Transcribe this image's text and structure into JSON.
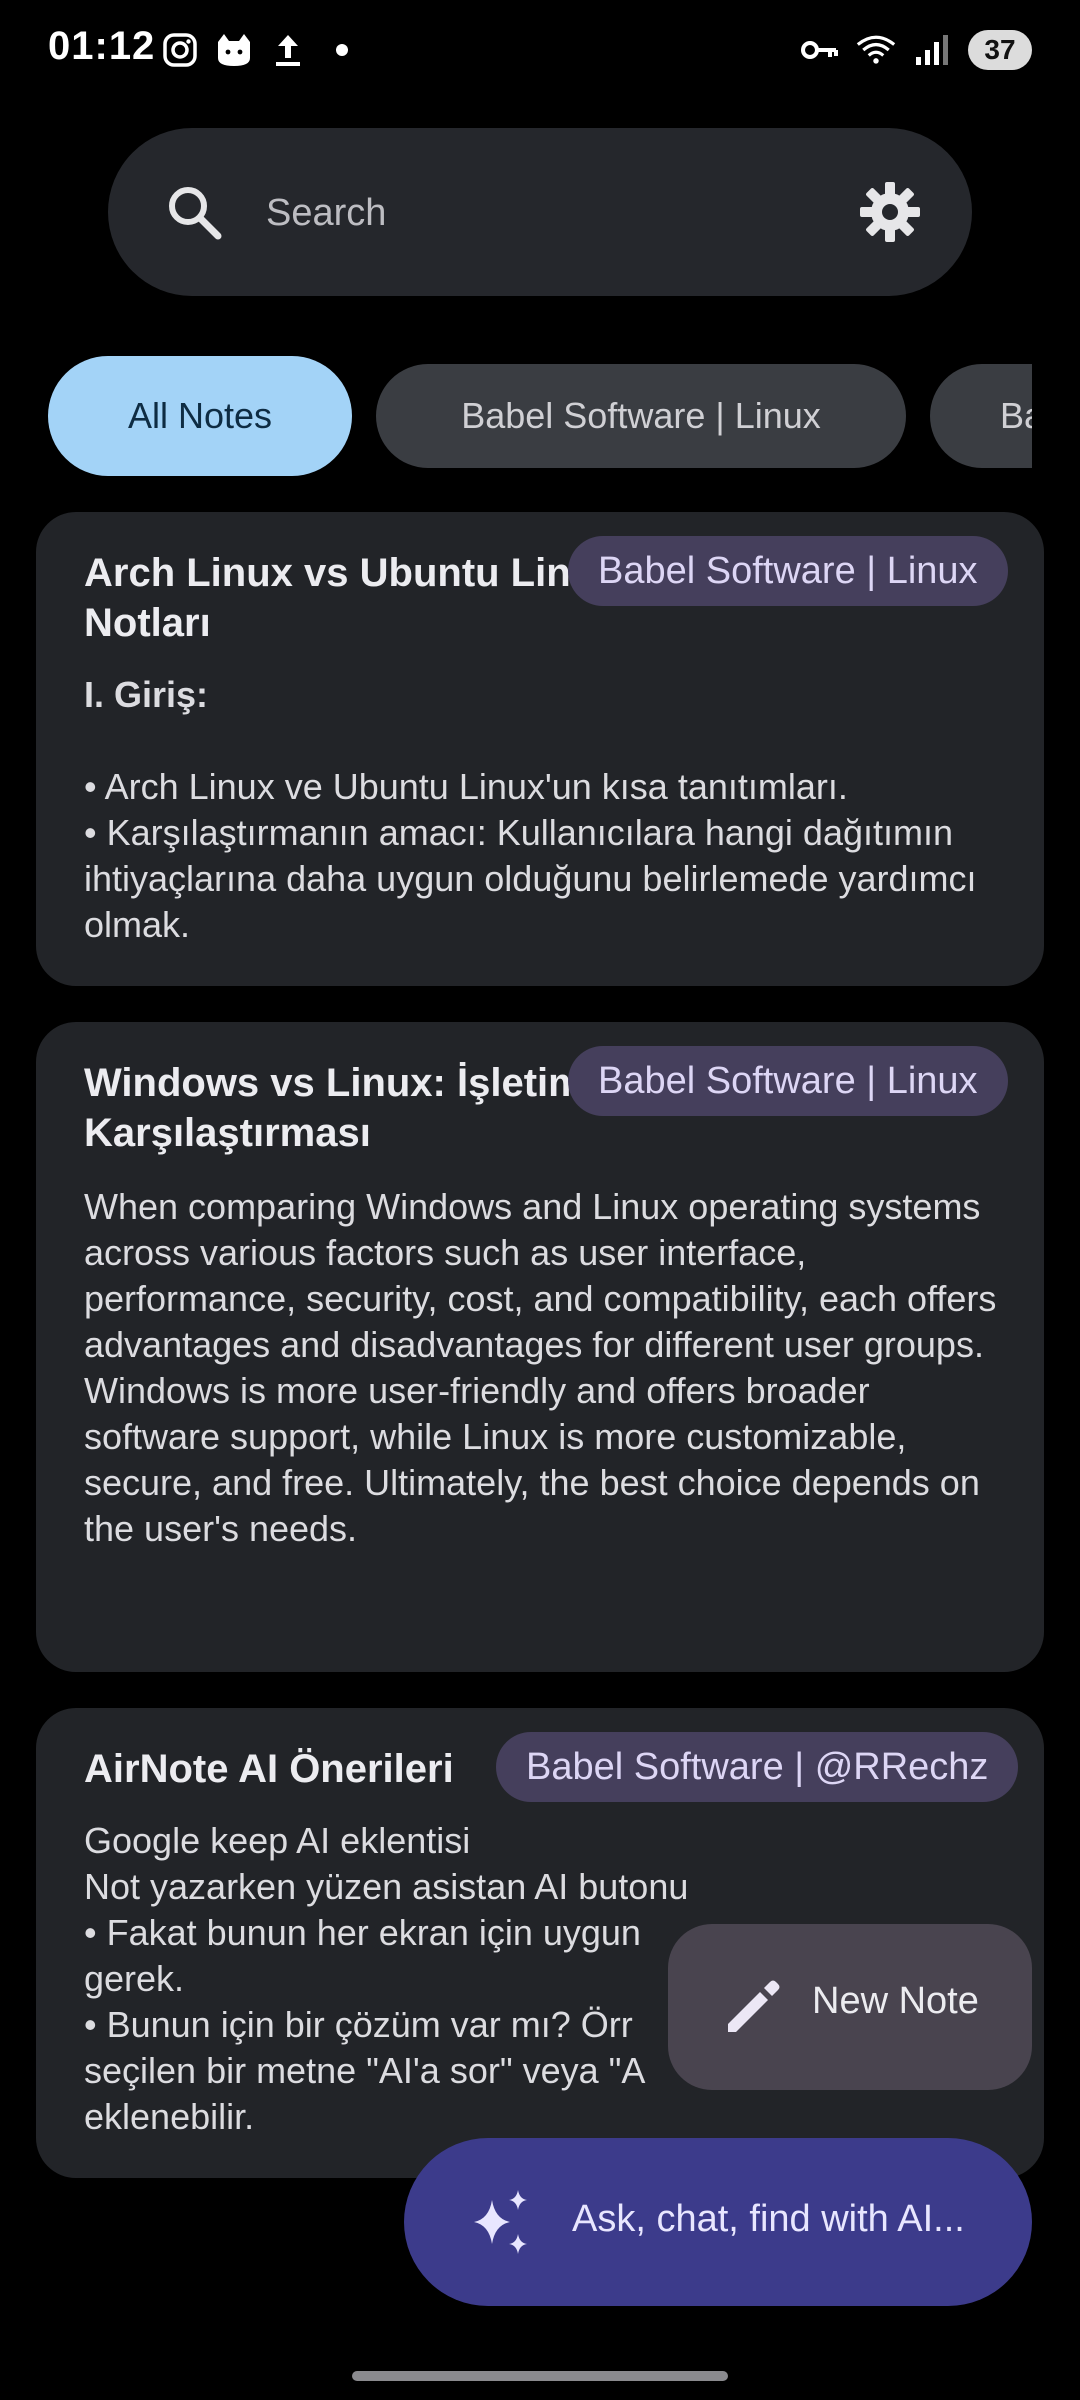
{
  "status_bar": {
    "time": "01:12",
    "battery": "37",
    "left_icons": [
      "instagram-icon",
      "cat-app-icon",
      "upload-icon",
      "dot-icon"
    ],
    "right_icons": [
      "vpn-key-icon",
      "wifi-icon",
      "signal-icon",
      "battery-icon"
    ]
  },
  "search": {
    "placeholder": "Search",
    "icon": "search-icon",
    "settings_icon": "gear-icon"
  },
  "chips": [
    {
      "label": "All Notes",
      "active": true
    },
    {
      "label": "Babel Software | Linux",
      "active": false
    },
    {
      "label": "Ba",
      "active": false
    }
  ],
  "notes": [
    {
      "title": "Arch Linux vs Ubuntu Linux Karşılaştırma Notları",
      "title_visible": "Arch Linux vs Ubuntu Linu",
      "title_line2": "Notları",
      "tag": "Babel Software | Linux",
      "subhead": "I. Giriş:",
      "body": "• Arch Linux ve Ubuntu Linux'un kısa tanıtımları.\n• Karşılaştırmanın amacı: Kullanıcılara hangi dağıtımın ihtiyaçlarına daha uygun olduğunu belirlemede yardımcı olmak."
    },
    {
      "title_visible": "Windows vs Linux: İşletim",
      "title_line2": "Karşılaştırması",
      "tag": "Babel Software | Linux",
      "body": "When comparing Windows and Linux operating systems across various factors such as user interface, performance, security, cost, and compatibility, each offers advantages and disadvantages for different user groups.  Windows is more user-friendly and offers broader software support, while Linux is more customizable, secure, and free.  Ultimately, the best choice depends on the user's needs."
    },
    {
      "title_visible": "AirNote AI Önerileri",
      "tag": "Babel Software | @RRechz",
      "body": "Google keep AI eklentisi\nNot yazarken yüzen asistan AI butonu\n• Fakat bunun her ekran için uygun \ngerek.\n• Bunun için bir çözüm var mı? Örr\nseçilen bir metne \"AI'a sor\" veya \"A\neklenebilir."
    }
  ],
  "fab_new": {
    "label": "New Note",
    "icon": "pencil-icon"
  },
  "fab_ai": {
    "label": "Ask, chat, find with AI...",
    "icon": "sparkle-icon"
  },
  "colors": {
    "background": "#000000",
    "card": "#222428",
    "chip_active": "#a3d3f7",
    "chip_inactive": "#3a3d42",
    "tag": "#453f5c",
    "fab_ai": "#3c3b8b",
    "fab_new": "#49444f"
  }
}
